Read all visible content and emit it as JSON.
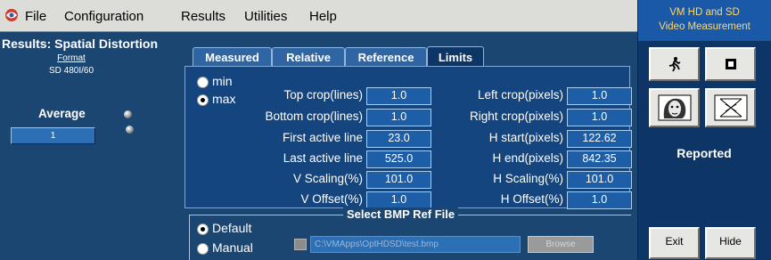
{
  "menubar": {
    "items": [
      "File",
      "Configuration",
      "Results",
      "Utilities",
      "Help"
    ]
  },
  "right_title": {
    "line1": "VM HD and SD",
    "line2": "Video Measurement"
  },
  "results": {
    "title": "Results: Spatial Distortion",
    "format_label": "Format",
    "format_value": "SD 480I/60",
    "average_label": "Average",
    "average_value": "1"
  },
  "tabs": [
    {
      "label": "Measured",
      "active": false
    },
    {
      "label": "Relative",
      "active": false
    },
    {
      "label": "Reference",
      "active": false
    },
    {
      "label": "Limits",
      "active": true
    }
  ],
  "limit_mode": {
    "options": [
      "min",
      "max"
    ],
    "selected": "max"
  },
  "left_params": [
    {
      "label": "Top crop(lines)",
      "value": "1.0"
    },
    {
      "label": "Bottom crop(lines)",
      "value": "1.0"
    },
    {
      "label": "First active line",
      "value": "23.0"
    },
    {
      "label": "Last active line",
      "value": "525.0"
    },
    {
      "label": "V Scaling(%)",
      "value": "101.0"
    },
    {
      "label": "V Offset(%)",
      "value": "1.0"
    }
  ],
  "right_params": [
    {
      "label": "Left crop(pixels)",
      "value": "1.0"
    },
    {
      "label": "Right crop(pixels)",
      "value": "1.0"
    },
    {
      "label": "H start(pixels)",
      "value": "122.62"
    },
    {
      "label": "H end(pixels)",
      "value": "842.35"
    },
    {
      "label": "H Scaling(%)",
      "value": "101.0"
    },
    {
      "label": "H Offset(%)",
      "value": "1.0"
    }
  ],
  "bmp": {
    "title": "Select BMP Ref File",
    "options": [
      "Default",
      "Manual"
    ],
    "selected": "Default",
    "path": "C:\\VMApps\\OptHDSD\\test.bmp",
    "browse_label": "Browse"
  },
  "side_panel": {
    "reported_label": "Reported",
    "exit_label": "Exit",
    "hide_label": "Hide"
  }
}
